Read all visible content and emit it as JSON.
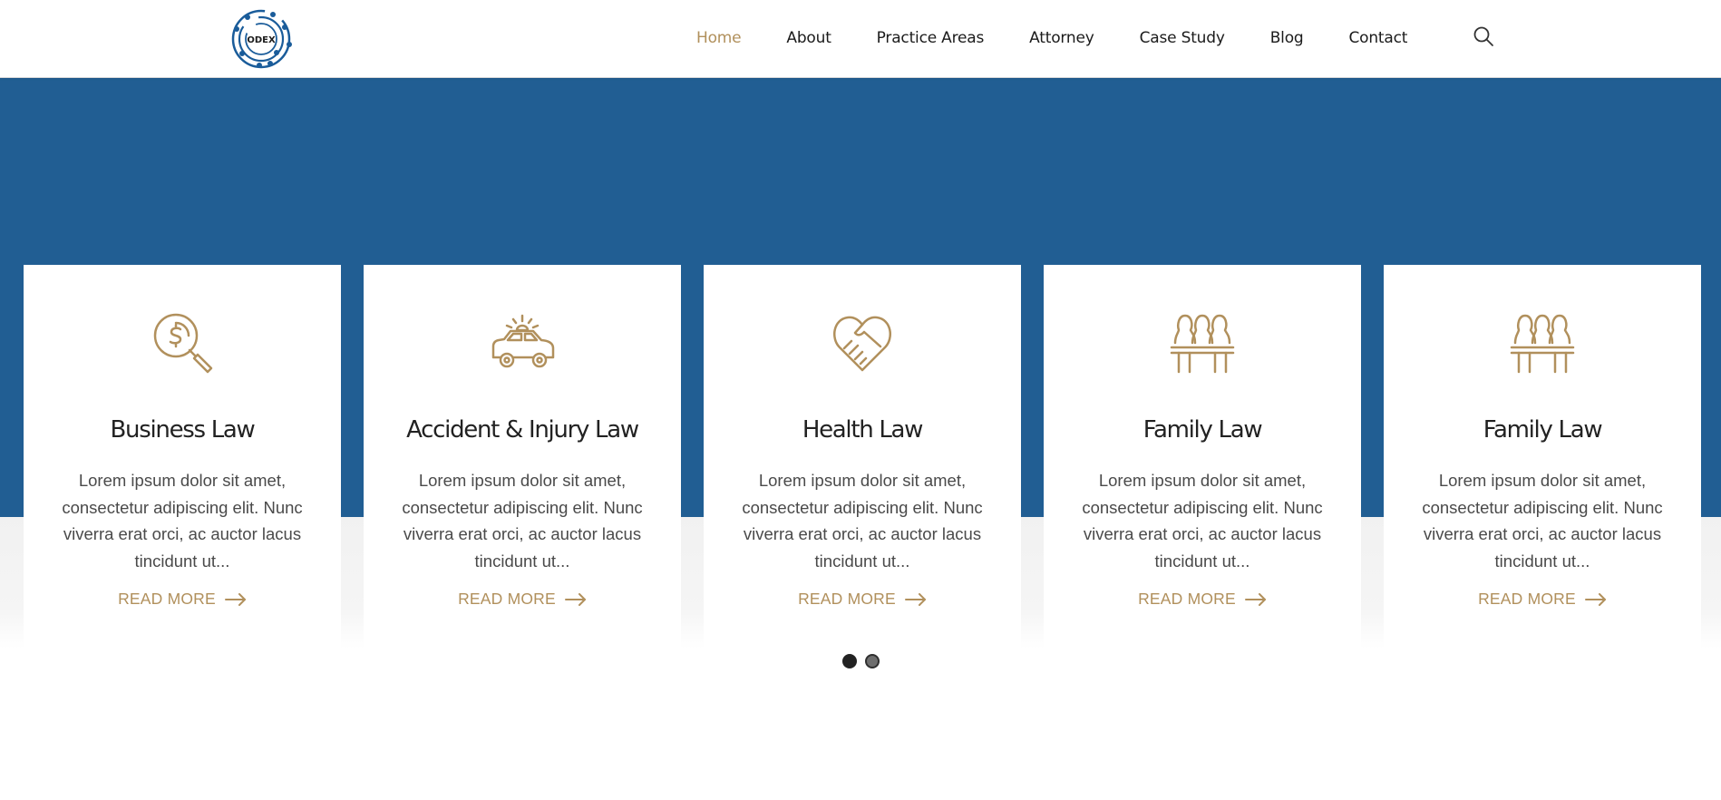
{
  "brand": {
    "logo_text": "ODEX",
    "primary_color": "#215e93",
    "accent_color": "#b1905c"
  },
  "nav": {
    "items": [
      {
        "label": "Home",
        "active": true
      },
      {
        "label": "About"
      },
      {
        "label": "Practice Areas"
      },
      {
        "label": "Attorney"
      },
      {
        "label": "Case Study"
      },
      {
        "label": "Blog"
      },
      {
        "label": "Contact"
      }
    ],
    "search_icon": "search-icon"
  },
  "cards": [
    {
      "icon": "magnifier-dollar-icon",
      "title": "Business Law",
      "text": "Lorem ipsum dolor sit amet, consectetur adipiscing elit. Nunc viverra erat orci, ac auctor lacus tincidunt ut...",
      "link": "READ MORE"
    },
    {
      "icon": "police-car-icon",
      "title": "Accident & Injury Law",
      "text": "Lorem ipsum dolor sit amet, consectetur adipiscing elit. Nunc viverra erat orci, ac auctor lacus tincidunt ut...",
      "link": "READ MORE"
    },
    {
      "icon": "heart-handshake-icon",
      "title": "Health Law",
      "text": "Lorem ipsum dolor sit amet, consectetur adipiscing elit. Nunc viverra erat orci, ac auctor lacus tincidunt ut...",
      "link": "READ MORE"
    },
    {
      "icon": "family-table-icon",
      "title": "Family Law",
      "text": "Lorem ipsum dolor sit amet, consectetur adipiscing elit. Nunc viverra erat orci, ac auctor lacus tincidunt ut...",
      "link": "READ MORE"
    },
    {
      "icon": "family-table-icon",
      "title": "Family Law",
      "text": "Lorem ipsum dolor sit amet, consectetur adipiscing elit. Nunc viverra erat orci, ac auctor lacus tincidunt ut...",
      "link": "READ MORE"
    }
  ],
  "carousel": {
    "pages": 2,
    "current": 1
  }
}
